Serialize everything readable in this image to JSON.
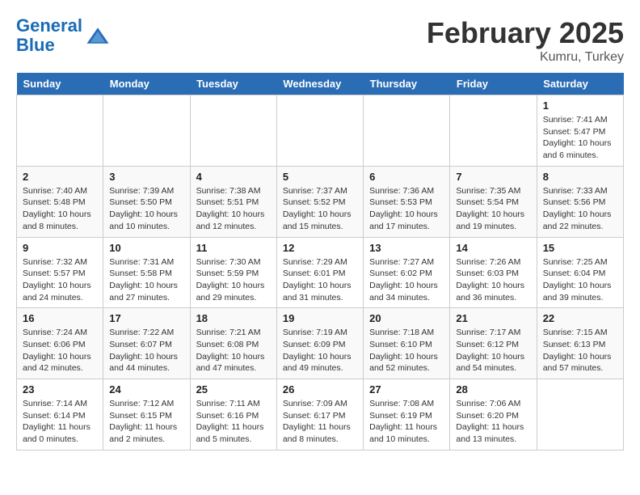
{
  "header": {
    "logo_line1": "General",
    "logo_line2": "Blue",
    "month": "February 2025",
    "location": "Kumru, Turkey"
  },
  "weekdays": [
    "Sunday",
    "Monday",
    "Tuesday",
    "Wednesday",
    "Thursday",
    "Friday",
    "Saturday"
  ],
  "weeks": [
    [
      {
        "day": "",
        "info": ""
      },
      {
        "day": "",
        "info": ""
      },
      {
        "day": "",
        "info": ""
      },
      {
        "day": "",
        "info": ""
      },
      {
        "day": "",
        "info": ""
      },
      {
        "day": "",
        "info": ""
      },
      {
        "day": "1",
        "info": "Sunrise: 7:41 AM\nSunset: 5:47 PM\nDaylight: 10 hours and 6 minutes."
      }
    ],
    [
      {
        "day": "2",
        "info": "Sunrise: 7:40 AM\nSunset: 5:48 PM\nDaylight: 10 hours and 8 minutes."
      },
      {
        "day": "3",
        "info": "Sunrise: 7:39 AM\nSunset: 5:50 PM\nDaylight: 10 hours and 10 minutes."
      },
      {
        "day": "4",
        "info": "Sunrise: 7:38 AM\nSunset: 5:51 PM\nDaylight: 10 hours and 12 minutes."
      },
      {
        "day": "5",
        "info": "Sunrise: 7:37 AM\nSunset: 5:52 PM\nDaylight: 10 hours and 15 minutes."
      },
      {
        "day": "6",
        "info": "Sunrise: 7:36 AM\nSunset: 5:53 PM\nDaylight: 10 hours and 17 minutes."
      },
      {
        "day": "7",
        "info": "Sunrise: 7:35 AM\nSunset: 5:54 PM\nDaylight: 10 hours and 19 minutes."
      },
      {
        "day": "8",
        "info": "Sunrise: 7:33 AM\nSunset: 5:56 PM\nDaylight: 10 hours and 22 minutes."
      }
    ],
    [
      {
        "day": "9",
        "info": "Sunrise: 7:32 AM\nSunset: 5:57 PM\nDaylight: 10 hours and 24 minutes."
      },
      {
        "day": "10",
        "info": "Sunrise: 7:31 AM\nSunset: 5:58 PM\nDaylight: 10 hours and 27 minutes."
      },
      {
        "day": "11",
        "info": "Sunrise: 7:30 AM\nSunset: 5:59 PM\nDaylight: 10 hours and 29 minutes."
      },
      {
        "day": "12",
        "info": "Sunrise: 7:29 AM\nSunset: 6:01 PM\nDaylight: 10 hours and 31 minutes."
      },
      {
        "day": "13",
        "info": "Sunrise: 7:27 AM\nSunset: 6:02 PM\nDaylight: 10 hours and 34 minutes."
      },
      {
        "day": "14",
        "info": "Sunrise: 7:26 AM\nSunset: 6:03 PM\nDaylight: 10 hours and 36 minutes."
      },
      {
        "day": "15",
        "info": "Sunrise: 7:25 AM\nSunset: 6:04 PM\nDaylight: 10 hours and 39 minutes."
      }
    ],
    [
      {
        "day": "16",
        "info": "Sunrise: 7:24 AM\nSunset: 6:06 PM\nDaylight: 10 hours and 42 minutes."
      },
      {
        "day": "17",
        "info": "Sunrise: 7:22 AM\nSunset: 6:07 PM\nDaylight: 10 hours and 44 minutes."
      },
      {
        "day": "18",
        "info": "Sunrise: 7:21 AM\nSunset: 6:08 PM\nDaylight: 10 hours and 47 minutes."
      },
      {
        "day": "19",
        "info": "Sunrise: 7:19 AM\nSunset: 6:09 PM\nDaylight: 10 hours and 49 minutes."
      },
      {
        "day": "20",
        "info": "Sunrise: 7:18 AM\nSunset: 6:10 PM\nDaylight: 10 hours and 52 minutes."
      },
      {
        "day": "21",
        "info": "Sunrise: 7:17 AM\nSunset: 6:12 PM\nDaylight: 10 hours and 54 minutes."
      },
      {
        "day": "22",
        "info": "Sunrise: 7:15 AM\nSunset: 6:13 PM\nDaylight: 10 hours and 57 minutes."
      }
    ],
    [
      {
        "day": "23",
        "info": "Sunrise: 7:14 AM\nSunset: 6:14 PM\nDaylight: 11 hours and 0 minutes."
      },
      {
        "day": "24",
        "info": "Sunrise: 7:12 AM\nSunset: 6:15 PM\nDaylight: 11 hours and 2 minutes."
      },
      {
        "day": "25",
        "info": "Sunrise: 7:11 AM\nSunset: 6:16 PM\nDaylight: 11 hours and 5 minutes."
      },
      {
        "day": "26",
        "info": "Sunrise: 7:09 AM\nSunset: 6:17 PM\nDaylight: 11 hours and 8 minutes."
      },
      {
        "day": "27",
        "info": "Sunrise: 7:08 AM\nSunset: 6:19 PM\nDaylight: 11 hours and 10 minutes."
      },
      {
        "day": "28",
        "info": "Sunrise: 7:06 AM\nSunset: 6:20 PM\nDaylight: 11 hours and 13 minutes."
      },
      {
        "day": "",
        "info": ""
      }
    ]
  ]
}
